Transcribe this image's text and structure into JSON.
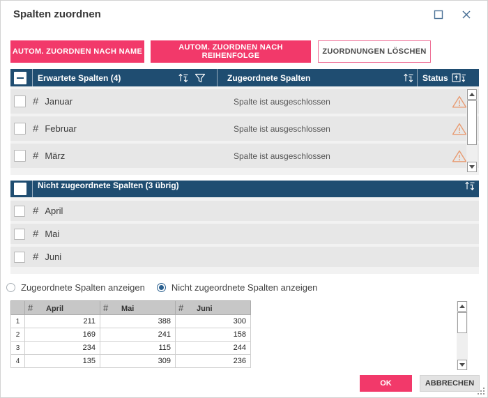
{
  "dialog": {
    "title": "Spalten zuordnen"
  },
  "toolbar": {
    "auto_by_name": "AUTOM. ZUORDNEN NACH NAME",
    "auto_by_order": "AUTOM. ZUORDNEN NACH REIHENFOLGE",
    "clear_mappings": "ZUORDNUNGEN LÖSCHEN"
  },
  "expected_table": {
    "checkbox_state": "indeterminate",
    "col_expected": "Erwartete Spalten (4)",
    "col_mapped": "Zugeordnete Spalten",
    "col_status": "Status",
    "rows": [
      {
        "type_icon": "#",
        "name": "Januar",
        "mapped": "Spalte ist ausgeschlossen",
        "status": "warning"
      },
      {
        "type_icon": "#",
        "name": "Februar",
        "mapped": "Spalte ist ausgeschlossen",
        "status": "warning"
      },
      {
        "type_icon": "#",
        "name": "März",
        "mapped": "Spalte ist ausgeschlossen",
        "status": "warning"
      }
    ]
  },
  "unmapped_table": {
    "checkbox_state": "unchecked",
    "header": "Nicht zugeordnete Spalten (3 übrig)",
    "rows": [
      {
        "type_icon": "#",
        "name": "April"
      },
      {
        "type_icon": "#",
        "name": "Mai"
      },
      {
        "type_icon": "#",
        "name": "Juni"
      }
    ]
  },
  "view_options": {
    "mapped": {
      "label": "Zugeordnete Spalten anzeigen",
      "selected": false
    },
    "unmapped": {
      "label": "Nicht zugeordnete Spalten anzeigen",
      "selected": true
    }
  },
  "preview_grid": {
    "columns": [
      {
        "type_icon": "#",
        "label": "April"
      },
      {
        "type_icon": "#",
        "label": "Mai"
      },
      {
        "type_icon": "#",
        "label": "Juni"
      }
    ],
    "rows": [
      {
        "n": "1",
        "c0": "211",
        "c1": "388",
        "c2": "300"
      },
      {
        "n": "2",
        "c0": "169",
        "c1": "241",
        "c2": "158"
      },
      {
        "n": "3",
        "c0": "234",
        "c1": "115",
        "c2": "244"
      },
      {
        "n": "4",
        "c0": "135",
        "c1": "309",
        "c2": "236"
      }
    ]
  },
  "footer": {
    "ok": "OK",
    "cancel": "ABBRECHEN"
  },
  "colors": {
    "accent_pink": "#F2396A",
    "header_blue": "#1F4D71",
    "warning_orange": "#E89B72",
    "titlebar_icon_blue": "#4A7096"
  }
}
